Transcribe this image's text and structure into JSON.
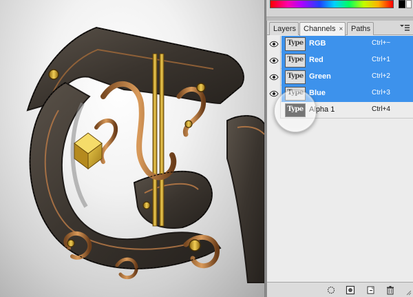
{
  "colors": {
    "selection_blue": "#3d92ec",
    "panel_bg": "#ececec"
  },
  "panel": {
    "tabs": [
      {
        "label": "Layers",
        "active": false
      },
      {
        "label": "Channels",
        "active": true,
        "close": "×"
      },
      {
        "label": "Paths",
        "active": false
      }
    ],
    "menu_icon": "panel-menu-icon"
  },
  "channels": [
    {
      "name": "RGB",
      "shortcut": "Ctrl+~",
      "selected": true,
      "visible": true,
      "thumb": "Type"
    },
    {
      "name": "Red",
      "shortcut": "Ctrl+1",
      "selected": true,
      "visible": true,
      "thumb": "Type"
    },
    {
      "name": "Green",
      "shortcut": "Ctrl+2",
      "selected": true,
      "visible": true,
      "thumb": "Type"
    },
    {
      "name": "Blue",
      "shortcut": "Ctrl+3",
      "selected": true,
      "visible": true,
      "thumb": "Type"
    },
    {
      "name": "Alpha 1",
      "shortcut": "Ctrl+4",
      "selected": false,
      "visible": false,
      "thumb": "Type"
    }
  ],
  "footer": {
    "icons": [
      "load-selection-icon",
      "save-selection-icon",
      "new-channel-icon",
      "delete-channel-icon"
    ]
  }
}
